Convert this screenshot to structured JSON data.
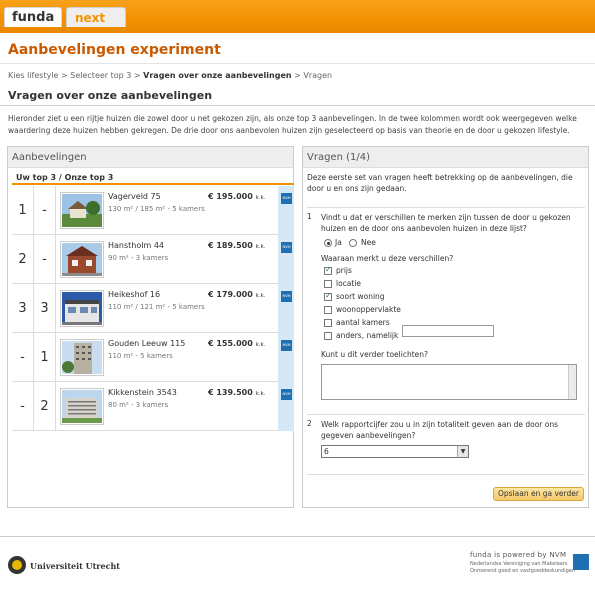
{
  "header": {
    "tab_funda": "funda",
    "tab_next": "next"
  },
  "page_title": "Aanbevelingen experiment",
  "breadcrumb": {
    "step1": "Kies lifestyle",
    "sep": ">",
    "step2": "Selecteer top 3",
    "step3": "Vragen over onze aanbevelingen",
    "step4": "Vragen"
  },
  "section_title": "Vragen over onze aanbevelingen",
  "intro": "Hieronder ziet u een rijtje huizen die zowel door u net gekozen zijn, als onze top 3 aanbevelingen. In de twee kolommen wordt ook weergegeven welke waardering deze huizen hebben gekregen. De drie door ons aanbevolen huizen zijn geselecteerd op basis van theorie en de door u gekozen lifestyle.",
  "left_panel": {
    "title": "Aanbevelingen",
    "table_header": "Uw top 3 / Onze top 3",
    "price_suffix": "k.k.",
    "houses": [
      {
        "rank_user": "1",
        "rank_ours": "-",
        "name": "Vagerveld 75",
        "meta": "130 m² / 185 m² - 5 kamers",
        "price": "€ 195.000",
        "photo": "house-green-photo"
      },
      {
        "rank_user": "2",
        "rank_ours": "-",
        "name": "Hanstholm 44",
        "meta": "90 m² - 3 kamers",
        "price": "€ 189.500",
        "photo": "brick-house-photo"
      },
      {
        "rank_user": "3",
        "rank_ours": "3",
        "name": "Heikeshof 16",
        "meta": "110 m² / 121 m² - 5 kamers",
        "price": "€ 179.000",
        "photo": "row-house-photo"
      },
      {
        "rank_user": "-",
        "rank_ours": "1",
        "name": "Gouden Leeuw 115",
        "meta": "110 m² - 5 kamers",
        "price": "€ 155.000",
        "photo": "tall-building-photo"
      },
      {
        "rank_user": "-",
        "rank_ours": "2",
        "name": "Kikkenstein 3543",
        "meta": "80 m² - 3 kamers",
        "price": "€ 139.500",
        "photo": "apartment-block-photo"
      }
    ],
    "nvm_label": "NVM"
  },
  "right_panel": {
    "title": "Vragen (1/4)",
    "intro": "Deze eerste set van vragen heeft betrekking op de aanbevelingen, die door u en ons zijn gedaan.",
    "q1": {
      "num": "1",
      "text": "Vindt u dat er verschillen te merken zijn tussen de door u gekozen huizen en de door ons aanbevolen huizen in deze lijst?",
      "opt_yes": "Ja",
      "opt_no": "Nee",
      "selected": "Ja",
      "sub_label": "Waaraan merkt u deze verschillen?",
      "checkboxes": [
        {
          "label": "prijs",
          "checked": true
        },
        {
          "label": "locatie",
          "checked": false
        },
        {
          "label": "soort woning",
          "checked": true
        },
        {
          "label": "woonoppervlakte",
          "checked": false
        },
        {
          "label": "aantal kamers",
          "checked": false
        },
        {
          "label": "anders, namelijk",
          "checked": false
        }
      ],
      "anders_value": "",
      "explain_label": "Kunt u dit verder toelichten?",
      "explain_value": ""
    },
    "q2": {
      "num": "2",
      "text": "Welk rapportcijfer zou u in zijn totaliteit geven aan de door ons gegeven aanbevelingen?",
      "selected": "6"
    },
    "save_label": "Opslaan en ga verder"
  },
  "footer": {
    "university": "Universiteit Utrecht",
    "powered": "funda is powered by NVM",
    "sub1": "Nederlandse Vereniging van Makelaars",
    "sub2": "Onroerend goed en vastgoeddeskundigen"
  }
}
